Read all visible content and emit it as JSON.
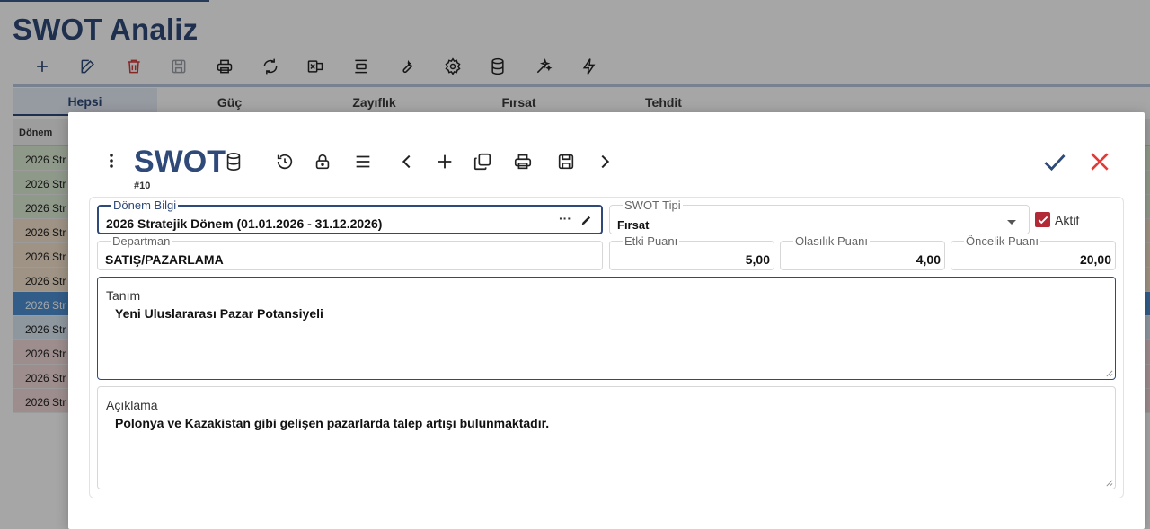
{
  "page": {
    "title": "SWOT Analiz",
    "toolbar": [
      {
        "name": "add-icon",
        "color": "#2f4a78"
      },
      {
        "name": "edit-icon",
        "color": "#2f4a78"
      },
      {
        "name": "delete-icon",
        "color": "#d23b3b"
      },
      {
        "name": "save-icon",
        "color": "#9aa0a8"
      },
      {
        "name": "print-icon",
        "color": "#222"
      },
      {
        "name": "refresh-icon",
        "color": "#222"
      },
      {
        "name": "excel-icon",
        "color": "#222"
      },
      {
        "name": "align-icon",
        "color": "#222"
      },
      {
        "name": "wrench-icon",
        "color": "#222"
      },
      {
        "name": "gear-icon",
        "color": "#222"
      },
      {
        "name": "database-icon",
        "color": "#222"
      },
      {
        "name": "magic-icon",
        "color": "#222"
      },
      {
        "name": "bolt-icon",
        "color": "#222"
      }
    ],
    "tabs": [
      "Hepsi",
      "Güç",
      "Zayıflık",
      "Fırsat",
      "Tehdit"
    ],
    "grid_header": "Dönem",
    "rows": [
      "2026 Str",
      "2026 Str",
      "2026 Str",
      "2026 Str",
      "2026 Str",
      "2026 Str",
      "2026 Str",
      "2026 Str",
      "2026 Str",
      "2026 Str",
      "2026 Str"
    ]
  },
  "modal": {
    "title": "SWOT",
    "record_id": "#10",
    "fields": {
      "donem": {
        "label": "Dönem Bilgi",
        "value": "2026 Stratejik Dönem (01.01.2026 - 31.12.2026)",
        "more": "···"
      },
      "swot_tipi": {
        "label": "SWOT Tipi",
        "value": "Fırsat"
      },
      "aktif": {
        "label": "Aktif",
        "checked": true
      },
      "departman": {
        "label": "Departman",
        "value": "SATIŞ/PAZARLAMA"
      },
      "etki": {
        "label": "Etki Puanı",
        "value": "5,00"
      },
      "olasilik": {
        "label": "Olasılık Puanı",
        "value": "4,00"
      },
      "oncelik": {
        "label": "Öncelik Puanı",
        "value": "20,00"
      },
      "tanim": {
        "label": "Tanım",
        "value": "Yeni Uluslararası Pazar Potansiyeli"
      },
      "aciklama": {
        "label": "Açıklama",
        "value": "Polonya ve Kazakistan gibi gelişen pazarlarda talep artışı bulunmaktadır."
      }
    },
    "colors": {
      "accent": "#2f4a78",
      "confirm": "#2f4a78",
      "close": "#e53935",
      "checkbox": "#b22a36"
    }
  }
}
